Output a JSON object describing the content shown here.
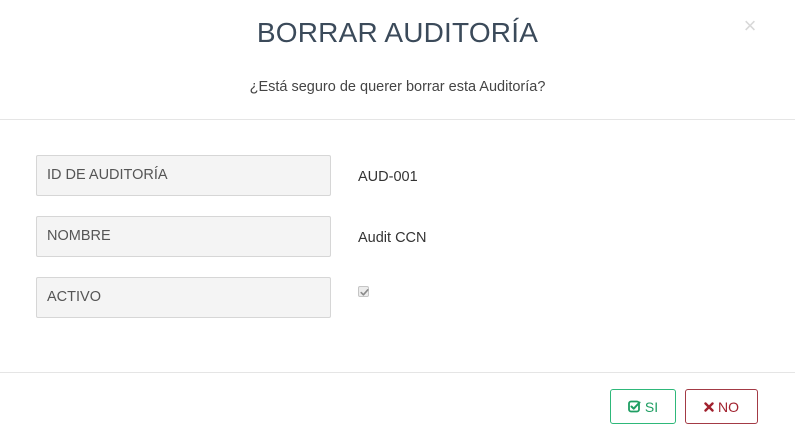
{
  "dialog": {
    "title": "BORRAR AUDITORÍA",
    "subtitle": "¿Está seguro de querer borrar esta Auditoría?",
    "close_icon": "close-icon",
    "close_glyph": "×"
  },
  "fields": [
    {
      "label": "ID DE AUDITORÍA",
      "value": "AUD-001"
    },
    {
      "label": "NOMBRE",
      "value": "Audit CCN"
    },
    {
      "label": "ACTIVO",
      "checked": true
    }
  ],
  "footer": {
    "si_label": "SI",
    "si_icon": "check-square-icon",
    "no_label": "NO",
    "no_icon": "x-icon"
  },
  "colors": {
    "title": "#3b4a5a",
    "si_button": "#2eb87a",
    "no_button": "#a33a45",
    "label_background": "#f4f4f4"
  }
}
